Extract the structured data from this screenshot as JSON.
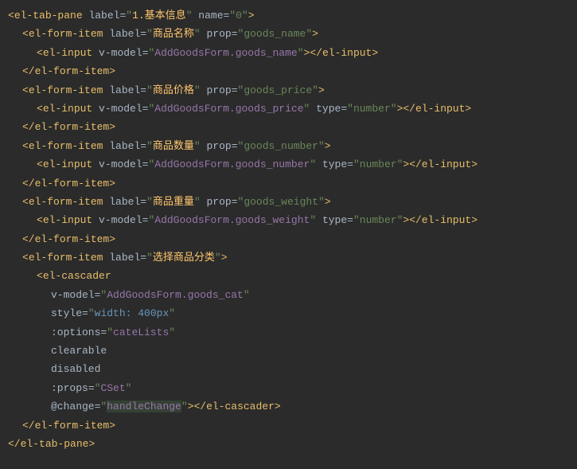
{
  "code": {
    "lines": [
      {
        "indent": 1,
        "tokens": [
          {
            "t": "<",
            "c": "tag-bracket"
          },
          {
            "t": "el-tab-pane",
            "c": "tag-name"
          },
          {
            "t": " label",
            "c": "attr-name"
          },
          {
            "t": "=",
            "c": "attr-eq"
          },
          {
            "t": "\"",
            "c": "attr-value"
          },
          {
            "t": "1.基本信息",
            "c": "string-label"
          },
          {
            "t": "\"",
            "c": "attr-value"
          },
          {
            "t": " name",
            "c": "attr-name"
          },
          {
            "t": "=",
            "c": "attr-eq"
          },
          {
            "t": "\"0\"",
            "c": "attr-value"
          },
          {
            "t": ">",
            "c": "tag-bracket"
          }
        ]
      },
      {
        "indent": 2,
        "tokens": [
          {
            "t": "<",
            "c": "tag-bracket"
          },
          {
            "t": "el-form-item",
            "c": "tag-name"
          },
          {
            "t": " label",
            "c": "attr-name"
          },
          {
            "t": "=",
            "c": "attr-eq"
          },
          {
            "t": "\"",
            "c": "attr-value"
          },
          {
            "t": "商品名称",
            "c": "string-label"
          },
          {
            "t": "\"",
            "c": "attr-value"
          },
          {
            "t": " prop",
            "c": "attr-name"
          },
          {
            "t": "=",
            "c": "attr-eq"
          },
          {
            "t": "\"goods_name\"",
            "c": "attr-value"
          },
          {
            "t": ">",
            "c": "tag-bracket"
          }
        ]
      },
      {
        "indent": 3,
        "tokens": [
          {
            "t": "<",
            "c": "tag-bracket"
          },
          {
            "t": "el-input",
            "c": "tag-name"
          },
          {
            "t": " v-model",
            "c": "attr-name"
          },
          {
            "t": "=",
            "c": "attr-eq"
          },
          {
            "t": "\"",
            "c": "attr-value"
          },
          {
            "t": "AddGoodsForm.goods_name",
            "c": "directive"
          },
          {
            "t": "\"",
            "c": "attr-value"
          },
          {
            "t": "></",
            "c": "tag-bracket"
          },
          {
            "t": "el-input",
            "c": "tag-name"
          },
          {
            "t": ">",
            "c": "tag-bracket"
          }
        ]
      },
      {
        "indent": 2,
        "tokens": [
          {
            "t": "</",
            "c": "tag-bracket"
          },
          {
            "t": "el-form-item",
            "c": "tag-name"
          },
          {
            "t": ">",
            "c": "tag-bracket"
          }
        ]
      },
      {
        "indent": 2,
        "tokens": [
          {
            "t": "<",
            "c": "tag-bracket"
          },
          {
            "t": "el-form-item",
            "c": "tag-name"
          },
          {
            "t": " label",
            "c": "attr-name"
          },
          {
            "t": "=",
            "c": "attr-eq"
          },
          {
            "t": "\"",
            "c": "attr-value"
          },
          {
            "t": "商品价格",
            "c": "string-label"
          },
          {
            "t": "\"",
            "c": "attr-value"
          },
          {
            "t": " prop",
            "c": "attr-name"
          },
          {
            "t": "=",
            "c": "attr-eq"
          },
          {
            "t": "\"goods_price\"",
            "c": "attr-value"
          },
          {
            "t": ">",
            "c": "tag-bracket"
          }
        ]
      },
      {
        "indent": 3,
        "tokens": [
          {
            "t": "<",
            "c": "tag-bracket"
          },
          {
            "t": "el-input",
            "c": "tag-name"
          },
          {
            "t": " v-model",
            "c": "attr-name"
          },
          {
            "t": "=",
            "c": "attr-eq"
          },
          {
            "t": "\"",
            "c": "attr-value"
          },
          {
            "t": "AddGoodsForm.goods_price",
            "c": "directive"
          },
          {
            "t": "\"",
            "c": "attr-value"
          },
          {
            "t": " type",
            "c": "attr-name"
          },
          {
            "t": "=",
            "c": "attr-eq"
          },
          {
            "t": "\"number\"",
            "c": "attr-value"
          },
          {
            "t": "></",
            "c": "tag-bracket"
          },
          {
            "t": "el-input",
            "c": "tag-name"
          },
          {
            "t": ">",
            "c": "tag-bracket"
          }
        ]
      },
      {
        "indent": 2,
        "tokens": [
          {
            "t": "</",
            "c": "tag-bracket"
          },
          {
            "t": "el-form-item",
            "c": "tag-name"
          },
          {
            "t": ">",
            "c": "tag-bracket"
          }
        ]
      },
      {
        "indent": 2,
        "tokens": [
          {
            "t": "<",
            "c": "tag-bracket"
          },
          {
            "t": "el-form-item",
            "c": "tag-name"
          },
          {
            "t": " label",
            "c": "attr-name"
          },
          {
            "t": "=",
            "c": "attr-eq"
          },
          {
            "t": "\"",
            "c": "attr-value"
          },
          {
            "t": "商品数量",
            "c": "string-label"
          },
          {
            "t": "\"",
            "c": "attr-value"
          },
          {
            "t": " prop",
            "c": "attr-name"
          },
          {
            "t": "=",
            "c": "attr-eq"
          },
          {
            "t": "\"goods_number\"",
            "c": "attr-value"
          },
          {
            "t": ">",
            "c": "tag-bracket"
          }
        ]
      },
      {
        "indent": 3,
        "tokens": [
          {
            "t": "<",
            "c": "tag-bracket"
          },
          {
            "t": "el-input",
            "c": "tag-name"
          },
          {
            "t": " v-model",
            "c": "attr-name"
          },
          {
            "t": "=",
            "c": "attr-eq"
          },
          {
            "t": "\"",
            "c": "attr-value"
          },
          {
            "t": "AddGoodsForm.goods_number",
            "c": "directive"
          },
          {
            "t": "\"",
            "c": "attr-value"
          },
          {
            "t": " type",
            "c": "attr-name"
          },
          {
            "t": "=",
            "c": "attr-eq"
          },
          {
            "t": "\"number\"",
            "c": "attr-value"
          },
          {
            "t": "></",
            "c": "tag-bracket"
          },
          {
            "t": "el-input",
            "c": "tag-name"
          },
          {
            "t": ">",
            "c": "tag-bracket"
          }
        ]
      },
      {
        "indent": 2,
        "tokens": [
          {
            "t": "</",
            "c": "tag-bracket"
          },
          {
            "t": "el-form-item",
            "c": "tag-name"
          },
          {
            "t": ">",
            "c": "tag-bracket"
          }
        ]
      },
      {
        "indent": 2,
        "tokens": [
          {
            "t": "<",
            "c": "tag-bracket"
          },
          {
            "t": "el-form-item",
            "c": "tag-name"
          },
          {
            "t": " label",
            "c": "attr-name"
          },
          {
            "t": "=",
            "c": "attr-eq"
          },
          {
            "t": "\"",
            "c": "attr-value"
          },
          {
            "t": "商品重量",
            "c": "string-label"
          },
          {
            "t": "\"",
            "c": "attr-value"
          },
          {
            "t": " prop",
            "c": "attr-name"
          },
          {
            "t": "=",
            "c": "attr-eq"
          },
          {
            "t": "\"goods_weight\"",
            "c": "attr-value"
          },
          {
            "t": ">",
            "c": "tag-bracket"
          }
        ]
      },
      {
        "indent": 3,
        "tokens": [
          {
            "t": "<",
            "c": "tag-bracket"
          },
          {
            "t": "el-input",
            "c": "tag-name"
          },
          {
            "t": " v-model",
            "c": "attr-name"
          },
          {
            "t": "=",
            "c": "attr-eq"
          },
          {
            "t": "\"",
            "c": "attr-value"
          },
          {
            "t": "AddGoodsForm.goods_weight",
            "c": "directive"
          },
          {
            "t": "\"",
            "c": "attr-value"
          },
          {
            "t": " type",
            "c": "attr-name"
          },
          {
            "t": "=",
            "c": "attr-eq"
          },
          {
            "t": "\"number\"",
            "c": "attr-value"
          },
          {
            "t": "></",
            "c": "tag-bracket"
          },
          {
            "t": "el-input",
            "c": "tag-name"
          },
          {
            "t": ">",
            "c": "tag-bracket"
          }
        ]
      },
      {
        "indent": 2,
        "tokens": [
          {
            "t": "</",
            "c": "tag-bracket"
          },
          {
            "t": "el-form-item",
            "c": "tag-name"
          },
          {
            "t": ">",
            "c": "tag-bracket"
          }
        ]
      },
      {
        "indent": 2,
        "tokens": [
          {
            "t": "<",
            "c": "tag-bracket"
          },
          {
            "t": "el-form-item",
            "c": "tag-name"
          },
          {
            "t": " label",
            "c": "attr-name"
          },
          {
            "t": "=",
            "c": "attr-eq"
          },
          {
            "t": "\"",
            "c": "attr-value"
          },
          {
            "t": "选择商品分类",
            "c": "string-label"
          },
          {
            "t": "\"",
            "c": "attr-value"
          },
          {
            "t": ">",
            "c": "tag-bracket"
          }
        ]
      },
      {
        "indent": 3,
        "tokens": [
          {
            "t": "<",
            "c": "tag-bracket"
          },
          {
            "t": "el-cascader",
            "c": "tag-name"
          }
        ]
      },
      {
        "indent": 4,
        "tokens": [
          {
            "t": "v-model",
            "c": "attr-name"
          },
          {
            "t": "=",
            "c": "attr-eq"
          },
          {
            "t": "\"",
            "c": "attr-value"
          },
          {
            "t": "AddGoodsForm.goods_cat",
            "c": "directive"
          },
          {
            "t": "\"",
            "c": "attr-value"
          }
        ]
      },
      {
        "indent": 4,
        "tokens": [
          {
            "t": "style",
            "c": "attr-name"
          },
          {
            "t": "=",
            "c": "attr-eq"
          },
          {
            "t": "\"",
            "c": "attr-value"
          },
          {
            "t": "width: 400px",
            "c": "css"
          },
          {
            "t": "\"",
            "c": "attr-value"
          }
        ]
      },
      {
        "indent": 4,
        "tokens": [
          {
            "t": ":options",
            "c": "attr-name"
          },
          {
            "t": "=",
            "c": "attr-eq"
          },
          {
            "t": "\"",
            "c": "attr-value"
          },
          {
            "t": "cateLists",
            "c": "directive"
          },
          {
            "t": "\"",
            "c": "attr-value"
          }
        ]
      },
      {
        "indent": 4,
        "tokens": [
          {
            "t": "clearable",
            "c": "attr-name"
          }
        ]
      },
      {
        "indent": 4,
        "tokens": [
          {
            "t": "disabled",
            "c": "attr-name"
          }
        ]
      },
      {
        "indent": 4,
        "tokens": [
          {
            "t": ":props",
            "c": "attr-name"
          },
          {
            "t": "=",
            "c": "attr-eq"
          },
          {
            "t": "\"",
            "c": "attr-value"
          },
          {
            "t": "CSet",
            "c": "directive"
          },
          {
            "t": "\"",
            "c": "attr-value"
          }
        ]
      },
      {
        "indent": 4,
        "tokens": [
          {
            "t": "@change",
            "c": "attr-name"
          },
          {
            "t": "=",
            "c": "attr-eq"
          },
          {
            "t": "\"",
            "c": "attr-value"
          },
          {
            "t": "handleChange",
            "c": "directive",
            "hl": true
          },
          {
            "t": "\"",
            "c": "attr-value"
          },
          {
            "t": "></",
            "c": "tag-bracket"
          },
          {
            "t": "el-cascader",
            "c": "tag-name"
          },
          {
            "t": ">",
            "c": "tag-bracket"
          }
        ]
      },
      {
        "indent": 2,
        "tokens": [
          {
            "t": "</",
            "c": "tag-bracket"
          },
          {
            "t": "el-form-item",
            "c": "tag-name"
          },
          {
            "t": ">",
            "c": "tag-bracket"
          }
        ]
      },
      {
        "indent": 1,
        "tokens": [
          {
            "t": "</",
            "c": "tag-bracket"
          },
          {
            "t": "el-tab-pane",
            "c": "tag-name"
          },
          {
            "t": ">",
            "c": "tag-bracket"
          }
        ]
      }
    ]
  }
}
